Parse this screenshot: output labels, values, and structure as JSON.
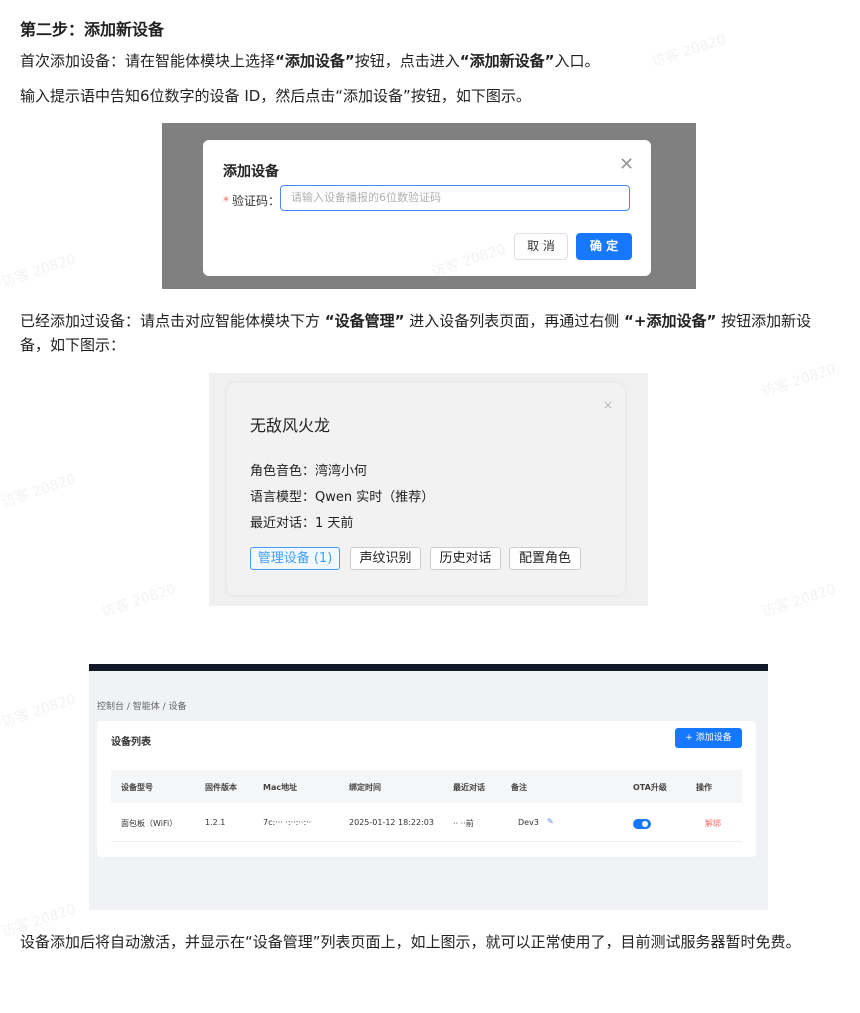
{
  "step_heading": "第二步：添加新设备",
  "para1": {
    "part1": "首次添加设备：请在智能体模块上选择",
    "bold1": "“添加设备”",
    "part2": "按钮，点击进入",
    "bold2": "“添加新设备”",
    "part3": "入口。"
  },
  "para2": "输入提示语中告知6位数字的设备 ID，然后点击“添加设备”按钮，如下图示。",
  "dialog": {
    "title": "添加设备",
    "close_glyph": "✕",
    "required_mark": "*",
    "field_label": "验证码：",
    "input_placeholder": "请输入设备播报的6位数验证码",
    "cancel_label": "取 消",
    "confirm_label": "确 定"
  },
  "para3": {
    "part1": "已经添加过设备：请点击对应智能体模块下方 ",
    "bold1": "“设备管理”",
    "part2": " 进入设备列表页面，再通过右侧 ",
    "bold2": "“+添加设备”",
    "part3": " 按钮添加新设备，如下图示："
  },
  "agent_card": {
    "close_glyph": "×",
    "name": "无敌风火龙",
    "voice_line": "角色音色：湾湾小何",
    "model_line": "语言模型：Qwen 实时（推荐）",
    "recent_line": "最近对话：1 天前",
    "tags": [
      "管理设备 (1)",
      "声纹识别",
      "历史对话",
      "配置角色"
    ]
  },
  "device_page": {
    "breadcrumb": "控制台 / 智能体 / 设备",
    "panel_title": "设备列表",
    "add_button": "+ 添加设备",
    "columns": [
      "设备型号",
      "固件版本",
      "Mac地址",
      "绑定时间",
      "最近对话",
      "备注",
      "OTA升级",
      "操作"
    ],
    "row": {
      "model": "面包板（WiFi）",
      "firmware": "1.2.1",
      "mac": "7c:··· ·:··:··:··",
      "bind_time": "2025-01-12 18:22:03",
      "recent": "·· ··前",
      "remark": "Dev3",
      "edit_glyph": "✎",
      "ota_enabled": true,
      "action": "解绑"
    }
  },
  "para4": "设备添加后将自动激活，并显示在“设备管理”列表页面上，如上图示，就可以正常使用了，目前测试服务器暂时免费。",
  "watermark": "访客 20820",
  "colors": {
    "primary": "#1677ff",
    "danger": "#f56c6c",
    "overlay": "#808080"
  }
}
